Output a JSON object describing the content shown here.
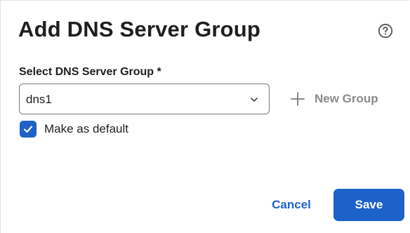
{
  "dialog": {
    "title": "Add DNS Server Group",
    "help_icon": "question-circle-icon"
  },
  "form": {
    "select_label": "Select DNS Server Group *",
    "select_value": "dns1",
    "new_group_label": "New Group",
    "default_checkbox": {
      "checked": true,
      "label": "Make as default"
    }
  },
  "footer": {
    "cancel_label": "Cancel",
    "save_label": "Save"
  },
  "colors": {
    "accent": "#1d62c8",
    "text": "#1f1f1f",
    "muted": "#8a8a8a"
  }
}
